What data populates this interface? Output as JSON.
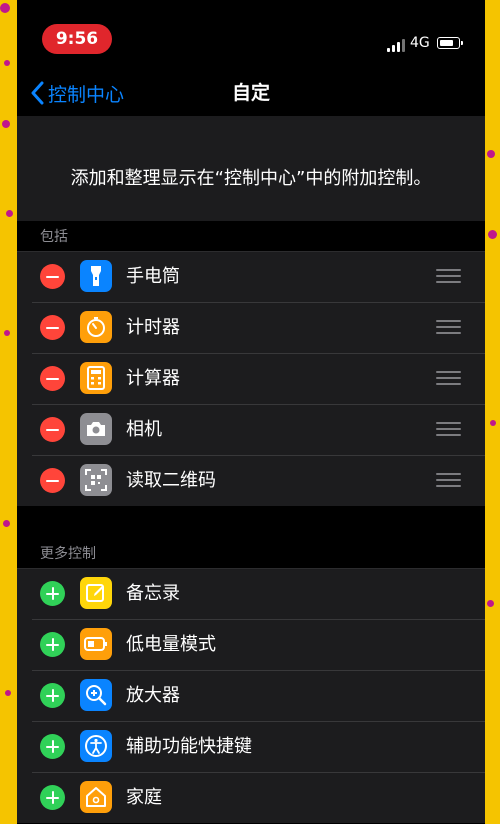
{
  "status": {
    "time": "9:56",
    "network": "4G",
    "battery_level": 0.8
  },
  "nav": {
    "back_label": "控制中心",
    "title": "自定"
  },
  "description": "添加和整理显示在“控制中心”中的附加控制。",
  "sections": {
    "included_header": "包括",
    "more_header": "更多控制"
  },
  "included": [
    {
      "label": "手电筒",
      "icon": "flashlight-icon",
      "color": "#0a84ff"
    },
    {
      "label": "计时器",
      "icon": "timer-icon",
      "color": "#ff9f0a"
    },
    {
      "label": "计算器",
      "icon": "calculator-icon",
      "color": "#ff9f0a"
    },
    {
      "label": "相机",
      "icon": "camera-icon",
      "color": "#8e8e93"
    },
    {
      "label": "读取二维码",
      "icon": "qr-code-icon",
      "color": "#8e8e93"
    }
  ],
  "more": [
    {
      "label": "备忘录",
      "icon": "notes-icon",
      "color": "#ffd60a"
    },
    {
      "label": "低电量模式",
      "icon": "low-power-icon",
      "color": "#ff9f0a"
    },
    {
      "label": "放大器",
      "icon": "magnifier-icon",
      "color": "#0a84ff"
    },
    {
      "label": "辅助功能快捷键",
      "icon": "accessibility-icon",
      "color": "#0a84ff"
    },
    {
      "label": "家庭",
      "icon": "home-icon",
      "color": "#ff9f0a"
    }
  ],
  "colors": {
    "accent": "#0a84ff",
    "remove": "#ff453a",
    "add": "#30d158",
    "background": "#f5c400"
  }
}
